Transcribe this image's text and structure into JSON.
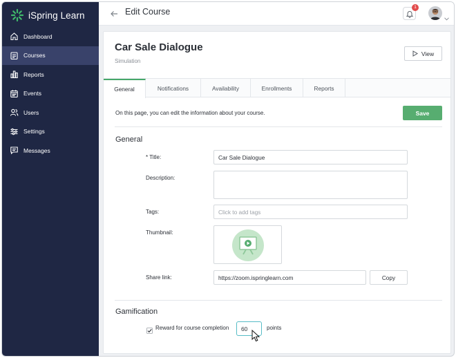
{
  "sidebar": {
    "brand": "iSpring Learn",
    "items": [
      {
        "label": "Dashboard",
        "icon": "home-icon",
        "active": false
      },
      {
        "label": "Courses",
        "icon": "courses-icon",
        "active": true
      },
      {
        "label": "Reports",
        "icon": "bar-chart-icon",
        "active": false
      },
      {
        "label": "Events",
        "icon": "calendar-icon",
        "active": false
      },
      {
        "label": "Users",
        "icon": "users-icon",
        "active": false
      },
      {
        "label": "Settings",
        "icon": "sliders-icon",
        "active": false
      },
      {
        "label": "Messages",
        "icon": "message-icon",
        "active": false
      }
    ]
  },
  "header": {
    "title": "Edit Course",
    "notifications_count": "1"
  },
  "course": {
    "title": "Car Sale Dialogue",
    "type": "Simulation",
    "view_label": "View"
  },
  "tabs": [
    {
      "label": "General",
      "active": true
    },
    {
      "label": "Notifications",
      "active": false
    },
    {
      "label": "Availability",
      "active": false
    },
    {
      "label": "Enrollments",
      "active": false
    },
    {
      "label": "Reports",
      "active": false
    }
  ],
  "intro_text": "On this page, you can edit the information about your course.",
  "save_label": "Save",
  "general": {
    "heading": "General",
    "title_label": "* Title:",
    "title_value": "Car Sale Dialogue",
    "description_label": "Description:",
    "description_value": "",
    "tags_label": "Tags:",
    "tags_placeholder": "Click to add tags",
    "thumbnail_label": "Thumbnail:",
    "share_label": "Share link:",
    "share_value": "https://zoom.ispringlearn.com",
    "copy_label": "Copy"
  },
  "gamification": {
    "heading": "Gamification",
    "reward_label": "Reward for course completion",
    "reward_checked": true,
    "points_value": "60",
    "points_label": "points"
  },
  "colors": {
    "sidebar_bg": "#1f2744",
    "sidebar_active": "#39426a",
    "brand_green": "#3fb86a",
    "save_green": "#57ad70",
    "badge_red": "#e24b4b",
    "focus_teal": "#56bcc6"
  }
}
